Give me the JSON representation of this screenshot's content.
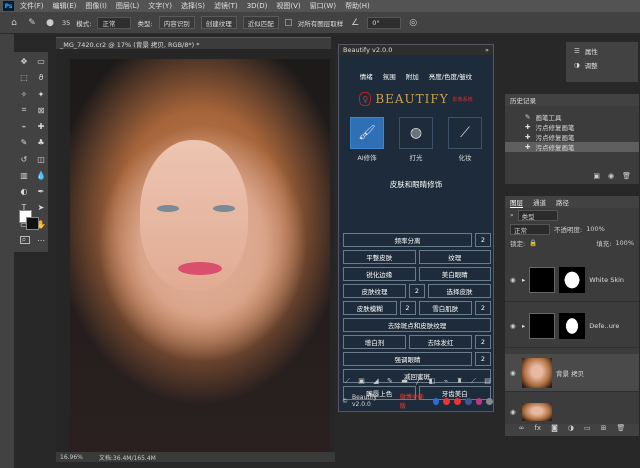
{
  "app": {
    "logo": "Ps"
  },
  "menu": [
    "文件(F)",
    "编辑(E)",
    "图像(I)",
    "图层(L)",
    "文字(Y)",
    "选择(S)",
    "滤镜(T)",
    "3D(D)",
    "视图(V)",
    "窗口(W)",
    "帮助(H)"
  ],
  "options": {
    "brush_size": "35",
    "mode_label": "模式:",
    "mode_value": "正常",
    "type_label": "类型:",
    "opt1": "内容识别",
    "opt2": "创建纹理",
    "opt3": "近似匹配",
    "sample_all": "对所有图层取样",
    "angle": "0°"
  },
  "document": {
    "tab": "_MG_7420.cr2 @ 17% (背景 拷贝, RGB/8*) *",
    "zoom": "16.96%",
    "doc_info": "文档:36.4M/165.4M"
  },
  "plugin": {
    "title": "Beautify v2.0.0",
    "tabs": [
      "情绪",
      "氛围",
      "附加",
      "亮度/色度/皱纹"
    ],
    "logo_text": "BEAUTIFY",
    "logo_sub": "影像系统",
    "modes": [
      {
        "label": "AI修饰",
        "active": true
      },
      {
        "label": "打光",
        "active": false
      },
      {
        "label": "化妆",
        "active": false
      }
    ],
    "section_title": "皮肤和眼睛修饰",
    "buttons": {
      "r1": [
        "频率分离",
        "2"
      ],
      "r2": [
        "平整皮肤",
        "纹理"
      ],
      "r3": [
        "锐化边缘",
        "美白眼睛"
      ],
      "r4": [
        "皮肤纹理",
        "2",
        "选择皮肤"
      ],
      "r5": [
        "皮肤模糊",
        "2",
        "雪白肌肤",
        "2"
      ],
      "r6": [
        "去除斑点和皮肤纹理"
      ],
      "r7": [
        "增白剂",
        "去除发红",
        "2"
      ],
      "r8": [
        "强调眼睛",
        "2"
      ],
      "r9": [
        "减回蜜斑"
      ],
      "r10": [
        "嘴唇上色",
        "牙齿美白"
      ]
    },
    "footer": {
      "version": "Beautify v2.0.0",
      "edition": "微博全能版"
    }
  },
  "props": {
    "item1": "属性",
    "item2": "调整"
  },
  "history": {
    "title": "历史记录",
    "items": [
      "画笔工具",
      "污点修复画笔",
      "污点修复画笔",
      "污点修复画笔"
    ]
  },
  "layers": {
    "tabs": [
      "图层",
      "通道",
      "路径"
    ],
    "kind": "类型",
    "blend": "正常",
    "opacity_label": "不透明度:",
    "opacity": "100%",
    "lock_label": "锁定:",
    "fill_label": "填充:",
    "fill": "100%",
    "list": [
      {
        "name": "White Skin"
      },
      {
        "name": "Defe..ure"
      },
      {
        "name": "背景 拷贝"
      },
      {
        "name": ""
      }
    ]
  },
  "colors": {
    "accent": "#2f6fb5",
    "panel_bg": "#1d2b3a"
  }
}
